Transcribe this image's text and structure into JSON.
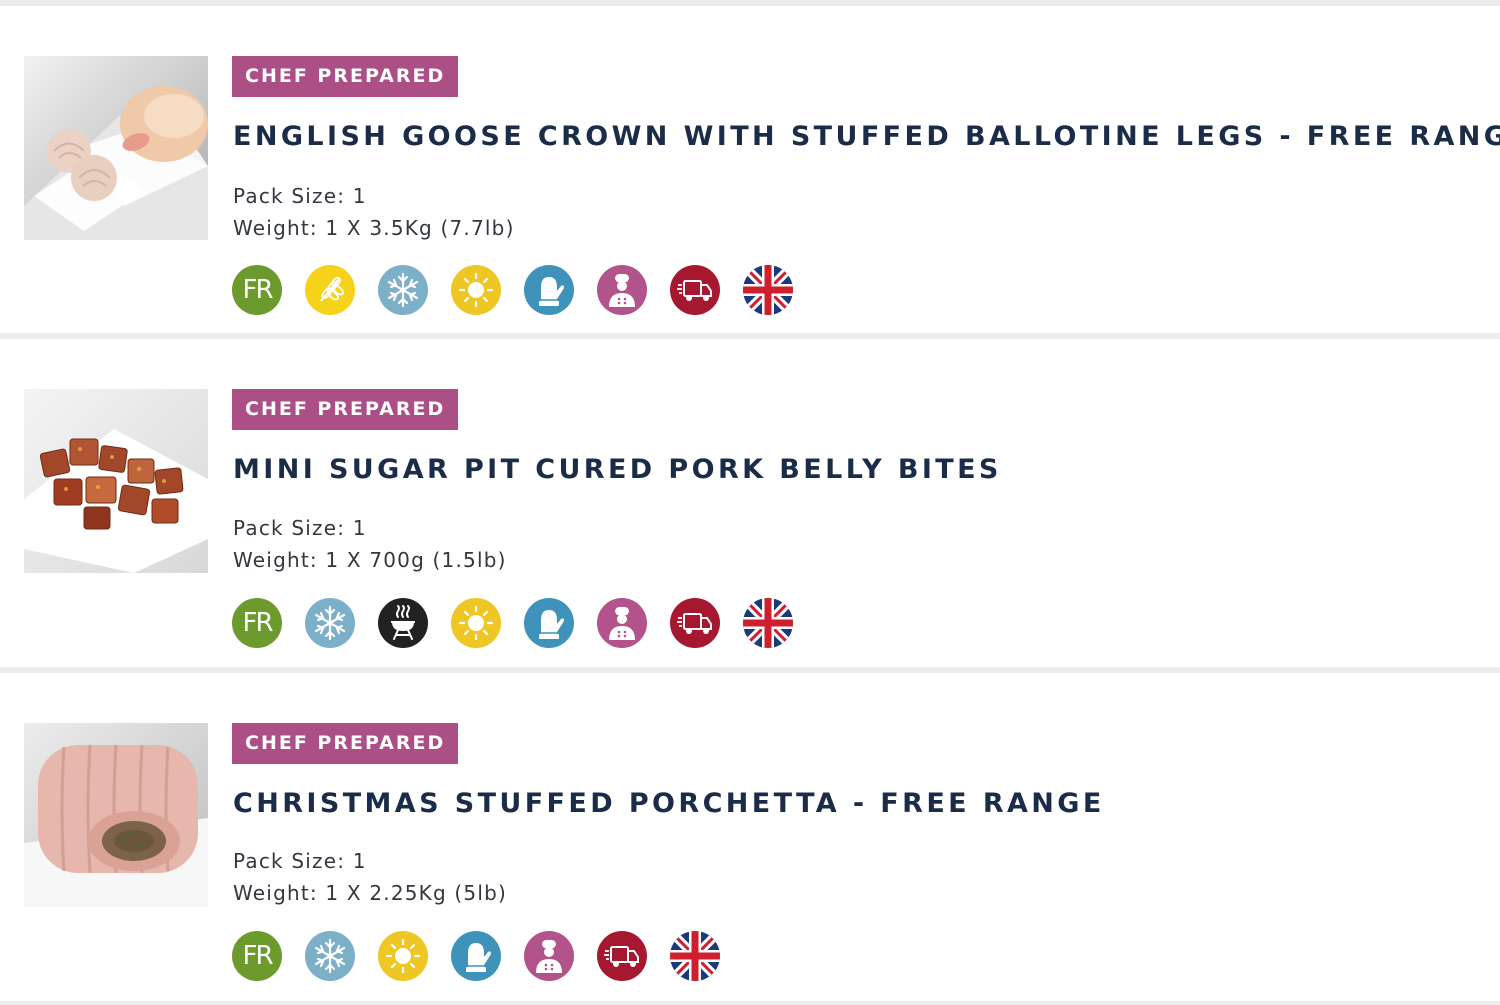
{
  "products": [
    {
      "badge": "CHEF PREPARED",
      "title": "ENGLISH GOOSE CROWN WITH STUFFED BALLOTINE LEGS - FREE RANGE",
      "pack_size_label": "Pack Size:",
      "pack_size": "1",
      "weight_label": "Weight:",
      "weight": "1 X 3.5Kg (7.7lb)",
      "image": "goose-crown-photo",
      "icons": [
        {
          "name": "free-range-icon",
          "text": "FR"
        },
        {
          "name": "wheat-icon"
        },
        {
          "name": "frozen-snowflake-icon"
        },
        {
          "name": "sun-icon"
        },
        {
          "name": "oven-glove-icon"
        },
        {
          "name": "chef-icon"
        },
        {
          "name": "delivery-truck-icon"
        },
        {
          "name": "uk-flag-icon"
        }
      ]
    },
    {
      "badge": "CHEF PREPARED",
      "title": "MINI SUGAR PIT CURED PORK BELLY BITES",
      "pack_size_label": "Pack Size:",
      "pack_size": "1",
      "weight_label": "Weight:",
      "weight": "1 X 700g (1.5lb)",
      "image": "pork-belly-bites-photo",
      "icons": [
        {
          "name": "free-range-icon",
          "text": "FR"
        },
        {
          "name": "frozen-snowflake-icon"
        },
        {
          "name": "barbecue-icon"
        },
        {
          "name": "sun-icon"
        },
        {
          "name": "oven-glove-icon"
        },
        {
          "name": "chef-icon"
        },
        {
          "name": "delivery-truck-icon"
        },
        {
          "name": "uk-flag-icon"
        }
      ]
    },
    {
      "badge": "CHEF PREPARED",
      "title": "CHRISTMAS STUFFED PORCHETTA - FREE RANGE",
      "pack_size_label": "Pack Size:",
      "pack_size": "1",
      "weight_label": "Weight:",
      "weight": "1 X 2.25Kg (5lb)",
      "image": "porchetta-photo",
      "icons": [
        {
          "name": "free-range-icon",
          "text": "FR"
        },
        {
          "name": "frozen-snowflake-icon"
        },
        {
          "name": "sun-icon"
        },
        {
          "name": "oven-glove-icon"
        },
        {
          "name": "chef-icon"
        },
        {
          "name": "delivery-truck-icon"
        },
        {
          "name": "uk-flag-icon"
        }
      ]
    }
  ],
  "colors": {
    "badge": "#ad4f87",
    "title": "#1a2c47",
    "free_range": "#6d9a2c",
    "wheat": "#f6d21a",
    "snowflake": "#7cb0c8",
    "sun": "#eec725",
    "glove": "#3f93bb",
    "chef": "#b3538b",
    "truck": "#a6182f",
    "bbq": "#222222"
  }
}
